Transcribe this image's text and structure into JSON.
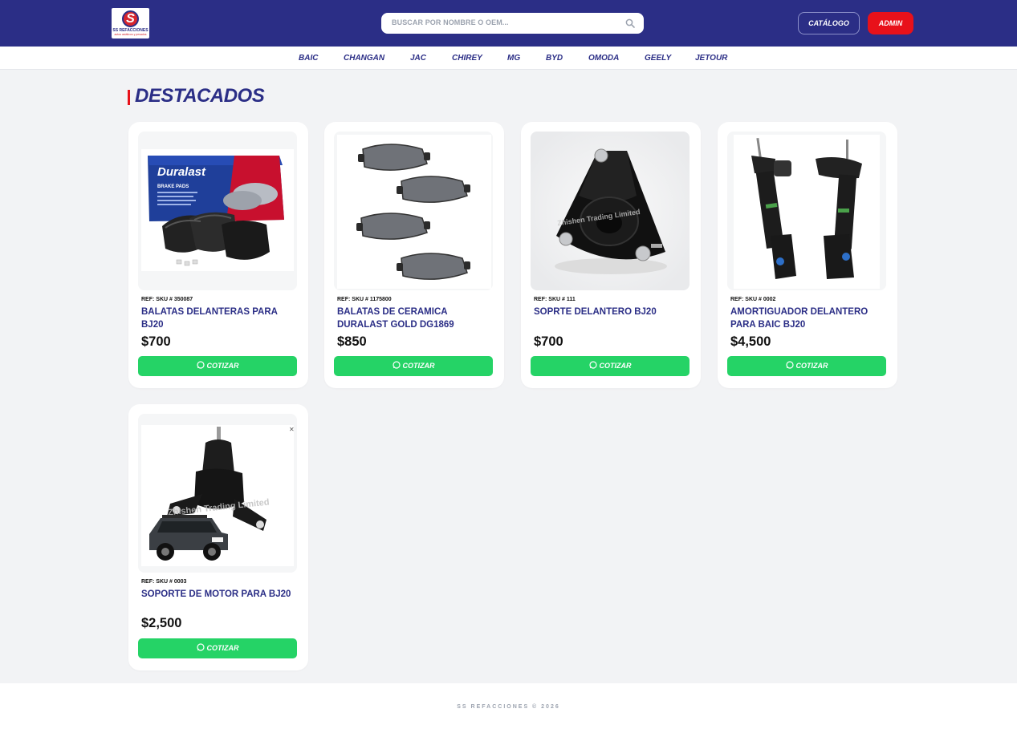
{
  "header": {
    "logo": {
      "mark": "S",
      "name": "SS REFACCIONES",
      "tagline": "autos asiáticos y pesados"
    },
    "search": {
      "placeholder": "BUSCAR POR NOMBRE O OEM...",
      "icon": "search-icon"
    },
    "catalog_label": "CATÁLOGO",
    "admin_label": "ADMIN"
  },
  "brands": [
    "BAIC",
    "CHANGAN",
    "JAC",
    "CHIREY",
    "MG",
    "BYD",
    "OMODA",
    "GEELY",
    "JETOUR"
  ],
  "section": {
    "title": "DESTACADOS"
  },
  "products": [
    {
      "ref": "REF: SKU # 350087",
      "name": "BALATAS DELANTERAS PARA BJ20",
      "price": "$700",
      "button": "COTIZAR",
      "image": "Duralast brake pads box"
    },
    {
      "ref": "REF: SKU # 1175800",
      "name": "BALATAS DE CERAMICA DURALAST GOLD DG1869",
      "price": "$850",
      "button": "COTIZAR",
      "image": "ceramic brake pads"
    },
    {
      "ref": "REF: SKU # 111",
      "name": "SOPRTE DELANTERO BJ20",
      "price": "$700",
      "button": "COTIZAR",
      "image": "strut mount"
    },
    {
      "ref": "REF: SKU # 0002",
      "name": "AMORTIGUADOR DELANTERO PARA BAIC BJ20",
      "price": "$4,500",
      "button": "COTIZAR",
      "image": "front shock absorbers"
    },
    {
      "ref": "REF: SKU # 0003",
      "name": "SOPORTE DE MOTOR PARA BJ20",
      "price": "$2,500",
      "button": "COTIZAR",
      "image": "engine mount with SUV"
    }
  ],
  "watermark": "Zhishen Trading Limited",
  "footer": {
    "text": "SS REFACCIONES © 2026"
  },
  "colors": {
    "primary": "#2b2e86",
    "accent": "#e8111a",
    "whatsapp": "#25d366",
    "background": "#f2f3f5"
  }
}
